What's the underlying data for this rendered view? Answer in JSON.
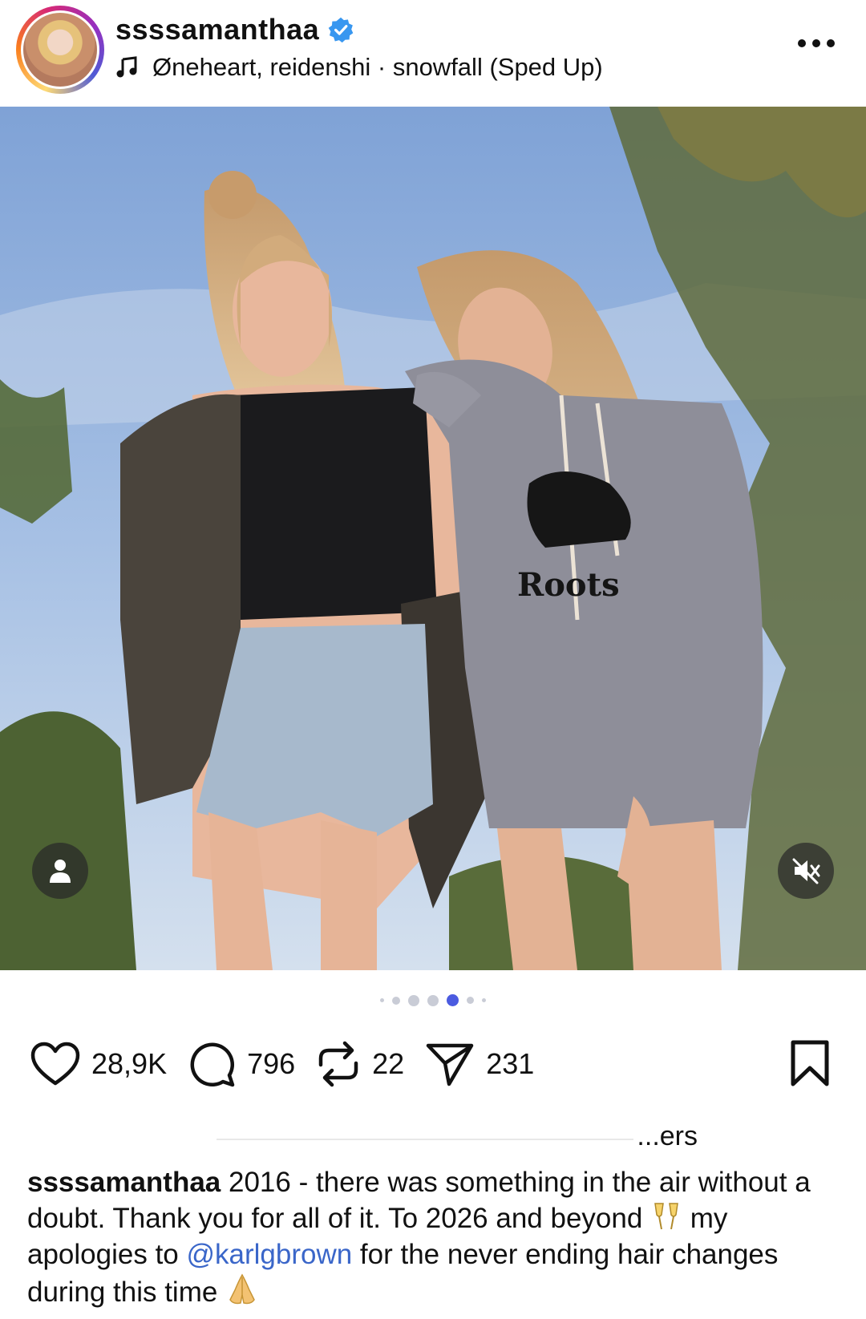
{
  "post": {
    "username": "ssssamanthaa",
    "audio": "Øneheart, reidenshi · snowfall (Sped Up)",
    "carousel": {
      "total": 7,
      "active": 4
    },
    "photo_logo": "Roots"
  },
  "actions": {
    "likes": "28,9K",
    "comments": "796",
    "reposts": "22",
    "shares": "231"
  },
  "liked_by_fragment": "...ers",
  "caption": {
    "username": "ssssamanthaa",
    "text_1": " 2016 - there was something in the air without a doubt. Thank you for all of it. To 2026 and beyond ",
    "text_2": " my apologies to ",
    "mention": "@karlgbrown",
    "text_3": " for the never ending hair changes during this time "
  },
  "colors": {
    "verified": "#3897f0",
    "mention": "#3a66c9",
    "sky": "#8fb0da"
  },
  "icons": [
    "music-note-icon",
    "verified-badge-icon",
    "more-icon",
    "user-tag-icon",
    "mute-icon",
    "heart-icon",
    "comment-icon",
    "repost-icon",
    "share-icon",
    "bookmark-icon",
    "champagne-icon",
    "praying-hands-icon"
  ]
}
